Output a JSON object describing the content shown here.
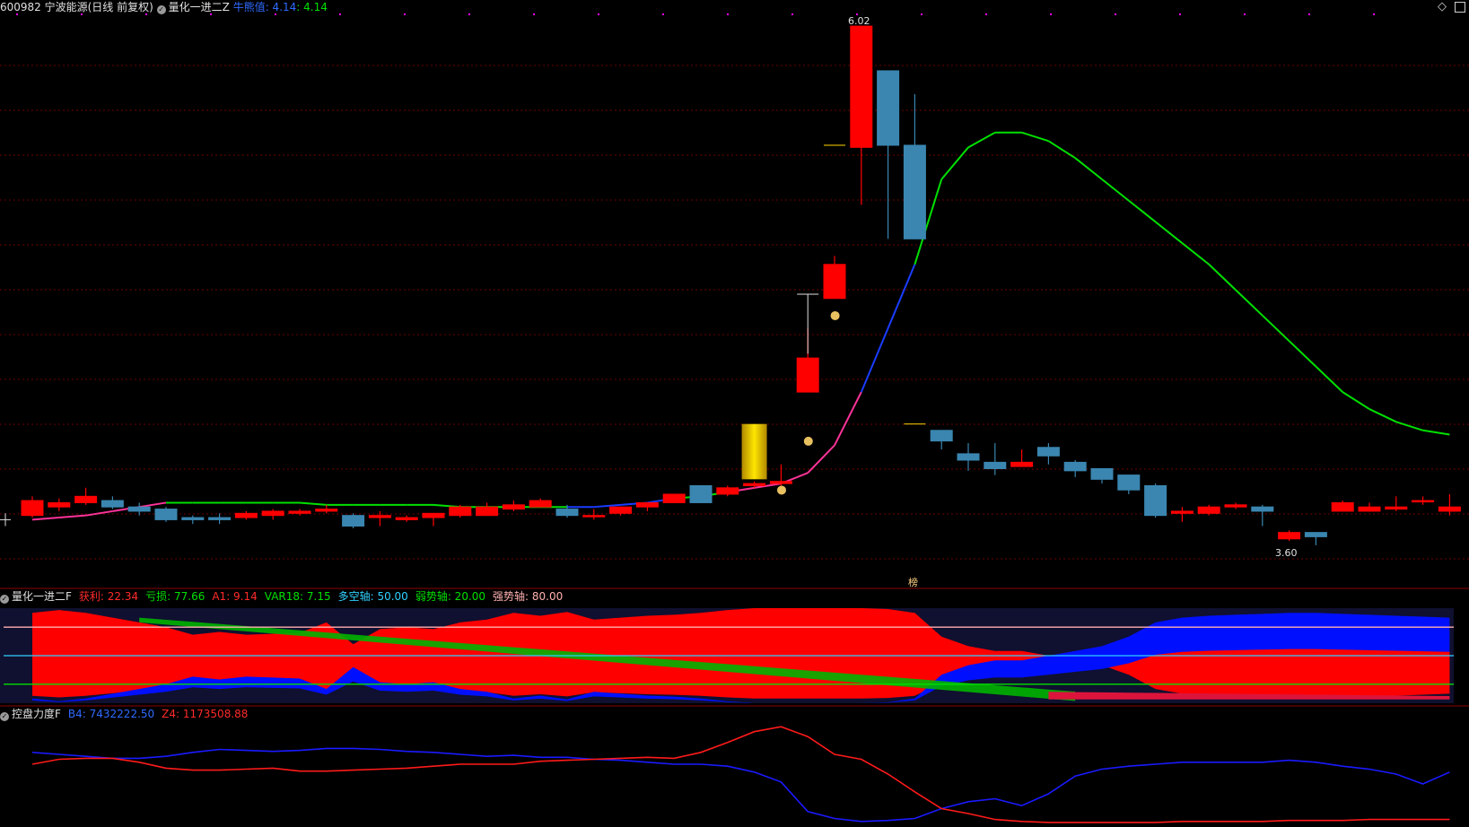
{
  "main_header": {
    "stock": "600982 宁波能源(日线 前复权)",
    "indicator": "量化一进二Z",
    "upper_line_label": "牛熊值: 4.14",
    "upper_line_value": ": 4.14"
  },
  "sub1_header": {
    "title": "量化一进二F",
    "profit": "获利: 22.34",
    "loss": "亏损: 77.66",
    "a1": "A1: 9.14",
    "var18": "VAR18: 7.15",
    "axis": "多空轴: 50.00",
    "weak": "弱势轴: 20.00",
    "strong": "强势轴: 80.00"
  },
  "sub2_header": {
    "title": "控盘力度F",
    "b4": "B4: 7432222.50",
    "z4": "Z4: 1173508.88"
  },
  "annotations": {
    "high_label": "6.02",
    "low_label": "3.60",
    "bang_label": "榜"
  },
  "colors": {
    "up": "#ff0000",
    "down": "#3a86b0",
    "ma_green": "#00e000",
    "ma_blue": "#1a3cff",
    "ma_pink": "#ff3399",
    "grid": "#6b0000",
    "red_band": "#ff0000",
    "green_band": "#00b400",
    "blue_band": "#0010ff",
    "crimson_band": "#dc143c",
    "b4_line": "#1a1aff",
    "z4_line": "#ff1a1a"
  },
  "chart_data": [
    {
      "type": "candlestick",
      "x": [
        1,
        2,
        3,
        4,
        5,
        6,
        7,
        8,
        9,
        10,
        11,
        12,
        13,
        14,
        15,
        16,
        17,
        18,
        19,
        20,
        21,
        22,
        23,
        24,
        25,
        26,
        27,
        28,
        29,
        30,
        31,
        32,
        33,
        34,
        35,
        36,
        37,
        38,
        39,
        40,
        41,
        42,
        43,
        44,
        45,
        46,
        47,
        48,
        49,
        50,
        51,
        52,
        53,
        54
      ],
      "open": [
        3.72,
        3.76,
        3.78,
        3.79,
        3.76,
        3.75,
        3.71,
        3.71,
        3.71,
        3.72,
        3.73,
        3.74,
        3.72,
        3.71,
        3.7,
        3.71,
        3.72,
        3.72,
        3.75,
        3.76,
        3.75,
        3.72,
        3.73,
        3.76,
        3.78,
        3.86,
        3.82,
        3.86,
        3.87,
        4.3,
        4.74,
        5.45,
        5.81,
        5.46,
        4.12,
        4.01,
        3.97,
        3.95,
        4.04,
        3.97,
        3.94,
        3.91,
        3.86,
        3.73,
        3.73,
        3.76,
        3.76,
        3.61,
        3.64,
        3.74,
        3.74,
        3.75,
        3.79,
        3.74
      ],
      "close": [
        3.79,
        3.78,
        3.81,
        3.76,
        3.74,
        3.7,
        3.7,
        3.7,
        3.73,
        3.74,
        3.74,
        3.75,
        3.67,
        3.72,
        3.71,
        3.73,
        3.76,
        3.76,
        3.77,
        3.79,
        3.72,
        3.72,
        3.76,
        3.78,
        3.82,
        3.78,
        3.85,
        3.87,
        3.88,
        4.46,
        4.9,
        6.02,
        5.46,
        5.02,
        4.07,
        3.98,
        3.94,
        3.97,
        4.0,
        3.93,
        3.89,
        3.84,
        3.72,
        3.74,
        3.76,
        3.77,
        3.74,
        3.64,
        3.62,
        3.78,
        3.76,
        3.76,
        3.79,
        3.76
      ],
      "high": [
        3.81,
        3.8,
        3.85,
        3.81,
        3.78,
        3.76,
        3.72,
        3.73,
        3.74,
        3.75,
        3.75,
        3.77,
        3.73,
        3.74,
        3.72,
        3.73,
        3.77,
        3.78,
        3.79,
        3.8,
        3.77,
        3.75,
        3.76,
        3.78,
        3.82,
        3.86,
        3.86,
        3.88,
        3.96,
        4.6,
        4.94,
        6.02,
        5.51,
        5.7,
        4.08,
        4.06,
        4.06,
        4.03,
        4.06,
        3.98,
        3.93,
        3.9,
        3.87,
        3.76,
        3.77,
        3.78,
        3.77,
        3.65,
        3.62,
        3.79,
        3.78,
        3.81,
        3.81,
        3.82
      ],
      "low": [
        3.71,
        3.74,
        3.77,
        3.75,
        3.72,
        3.69,
        3.68,
        3.68,
        3.7,
        3.7,
        3.72,
        3.73,
        3.66,
        3.67,
        3.69,
        3.67,
        3.71,
        3.74,
        3.74,
        3.76,
        3.71,
        3.7,
        3.72,
        3.74,
        3.78,
        3.78,
        3.81,
        3.85,
        3.86,
        4.3,
        4.74,
        5.18,
        5.02,
        5.02,
        4.03,
        3.93,
        3.91,
        3.95,
        3.96,
        3.9,
        3.87,
        3.82,
        3.71,
        3.69,
        3.72,
        3.75,
        3.67,
        3.6,
        3.58,
        3.74,
        3.74,
        3.74,
        3.77,
        3.72
      ],
      "high_label": "6.02",
      "low_label": "3.60"
    },
    {
      "type": "line",
      "series": [
        {
          "values": [
            3.7,
            3.71,
            3.72,
            3.74,
            3.76,
            3.78,
            3.78,
            3.78,
            3.78,
            3.78,
            3.78,
            3.77,
            3.77,
            3.77,
            3.77,
            3.77,
            3.76,
            3.76,
            3.76,
            3.76,
            3.76,
            3.76,
            3.77,
            3.78,
            3.8,
            3.81,
            3.83,
            3.85,
            3.87,
            3.92,
            4.05,
            4.3,
            4.6,
            4.9,
            5.3,
            5.45,
            5.52,
            5.52,
            5.48,
            5.4,
            5.3,
            5.2,
            5.1,
            5.0,
            4.9,
            4.78,
            4.66,
            4.54,
            4.42,
            4.3,
            4.22,
            4.16,
            4.12,
            4.1
          ]
        }
      ]
    },
    {
      "type": "area",
      "ylim": [
        0,
        100
      ],
      "reference_lines": [
        20,
        50,
        80
      ],
      "series": [
        {
          "name": "获利",
          "values": [
            95,
            98,
            95,
            90,
            85,
            80,
            72,
            75,
            72,
            73,
            74,
            85,
            62,
            78,
            80,
            78,
            85,
            88,
            95,
            92,
            96,
            88,
            90,
            92,
            93,
            95,
            98,
            100,
            100,
            100,
            100,
            100,
            99,
            95,
            70,
            60,
            55,
            55,
            50,
            45,
            40,
            30,
            15,
            10,
            8,
            7,
            6,
            5,
            5,
            6,
            7,
            8,
            9,
            10
          ]
        },
        {
          "name": "亏损",
          "values": [
            5,
            2,
            5,
            10,
            15,
            20,
            28,
            25,
            28,
            27,
            26,
            15,
            38,
            22,
            20,
            22,
            15,
            12,
            5,
            8,
            4,
            12,
            10,
            8,
            7,
            5,
            2,
            0,
            0,
            0,
            0,
            0,
            1,
            5,
            30,
            40,
            45,
            45,
            50,
            55,
            60,
            70,
            85,
            90,
            92,
            93,
            94,
            95,
            95,
            94,
            93,
            92,
            91,
            90
          ]
        }
      ]
    },
    {
      "type": "line",
      "series": [
        {
          "name": "B4",
          "values": [
            0.72,
            0.7,
            0.68,
            0.66,
            0.66,
            0.68,
            0.72,
            0.75,
            0.74,
            0.73,
            0.74,
            0.76,
            0.76,
            0.75,
            0.73,
            0.72,
            0.7,
            0.68,
            0.69,
            0.67,
            0.67,
            0.65,
            0.64,
            0.62,
            0.6,
            0.6,
            0.58,
            0.52,
            0.42,
            0.12,
            0.05,
            0.02,
            0.03,
            0.05,
            0.15,
            0.22,
            0.25,
            0.18,
            0.3,
            0.48,
            0.55,
            0.58,
            0.6,
            0.62,
            0.62,
            0.62,
            0.62,
            0.64,
            0.62,
            0.58,
            0.55,
            0.5,
            0.4,
            0.52
          ]
        },
        {
          "name": "Z4",
          "values": [
            0.6,
            0.65,
            0.66,
            0.66,
            0.62,
            0.56,
            0.54,
            0.54,
            0.55,
            0.56,
            0.53,
            0.53,
            0.54,
            0.55,
            0.56,
            0.58,
            0.6,
            0.6,
            0.6,
            0.63,
            0.64,
            0.65,
            0.66,
            0.67,
            0.66,
            0.72,
            0.82,
            0.93,
            0.98,
            0.88,
            0.7,
            0.65,
            0.5,
            0.32,
            0.15,
            0.1,
            0.04,
            0.02,
            0.01,
            0.01,
            0.01,
            0.01,
            0.01,
            0.02,
            0.02,
            0.02,
            0.02,
            0.03,
            0.03,
            0.03,
            0.04,
            0.04,
            0.04,
            0.04
          ]
        }
      ]
    }
  ]
}
